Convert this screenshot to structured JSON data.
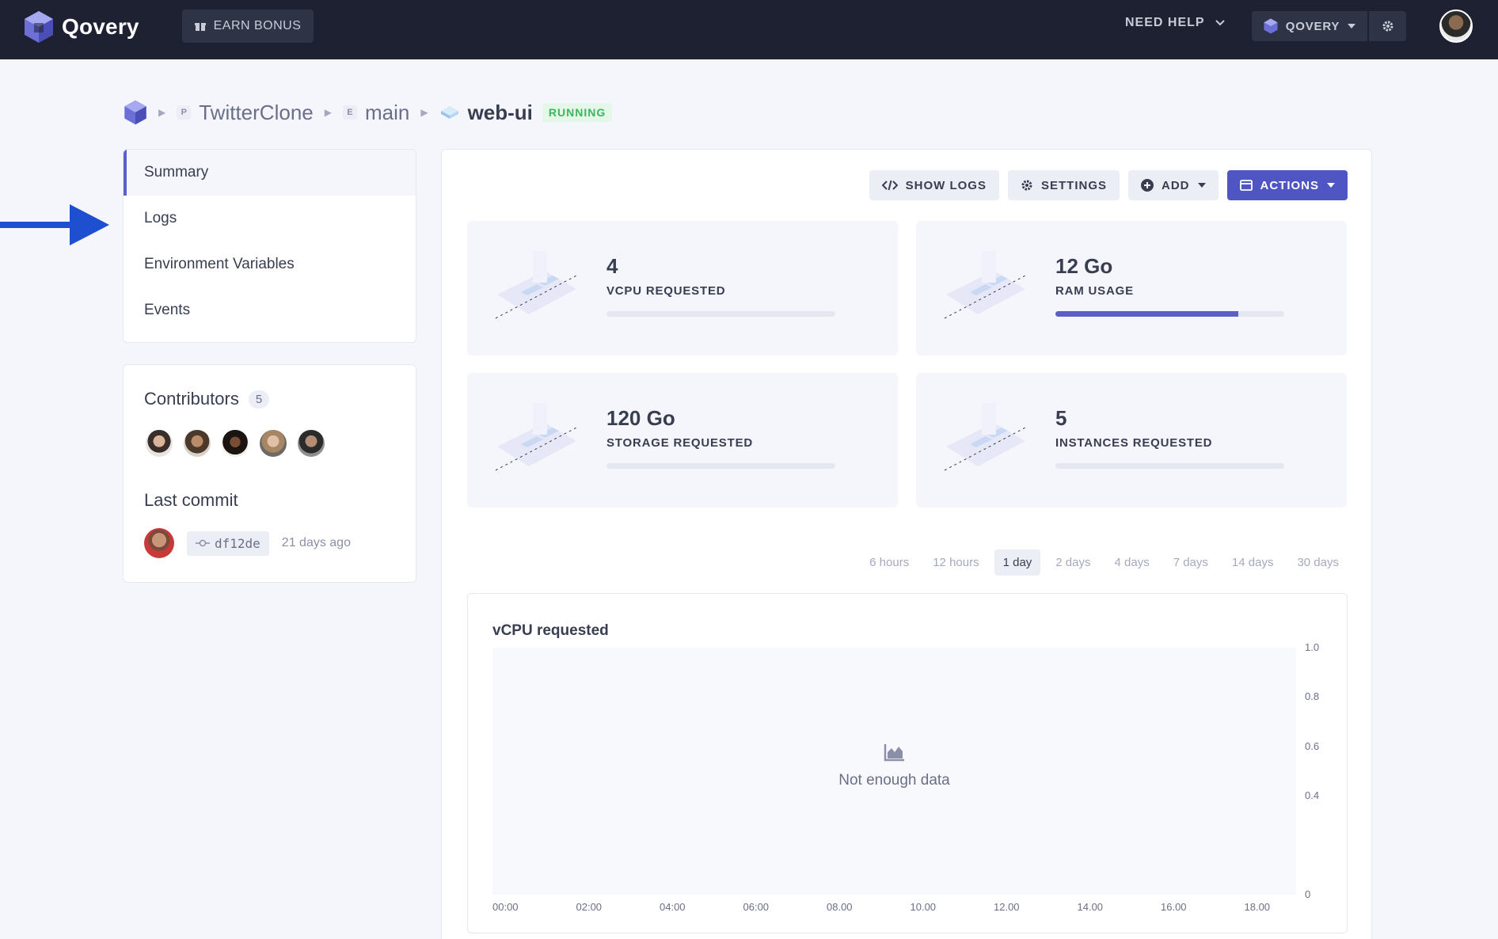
{
  "topbar": {
    "brand": "Qovery",
    "earn_bonus": "EARN BONUS",
    "need_help": "NEED HELP",
    "org_name": "QOVERY"
  },
  "breadcrumb": {
    "project_tag": "P",
    "project": "TwitterClone",
    "environment_tag": "E",
    "environment": "main",
    "application": "web-ui",
    "status": "RUNNING"
  },
  "sidebar": {
    "items": [
      {
        "label": "Summary",
        "active": true
      },
      {
        "label": "Logs",
        "active": false
      },
      {
        "label": "Environment Variables",
        "active": false
      },
      {
        "label": "Events",
        "active": false
      }
    ]
  },
  "contributors": {
    "title": "Contributors",
    "count": "5"
  },
  "last_commit": {
    "title": "Last commit",
    "hash": "df12de",
    "time_ago": "21 days ago"
  },
  "toolbar": {
    "show_logs": "SHOW LOGS",
    "settings": "SETTINGS",
    "add": "ADD",
    "actions": "ACTIONS"
  },
  "stats": [
    {
      "value": "4",
      "label": "VCPU REQUESTED",
      "fill": 0
    },
    {
      "value": "12 Go",
      "label": "RAM USAGE",
      "fill": 0.8
    },
    {
      "value": "120 Go",
      "label": "STORAGE REQUESTED",
      "fill": 0
    },
    {
      "value": "5",
      "label": "INSTANCES REQUESTED",
      "fill": 0
    }
  ],
  "time_ranges": [
    "6 hours",
    "12 hours",
    "1 day",
    "2 days",
    "4 days",
    "7 days",
    "14 days",
    "30 days"
  ],
  "selected_range": "1 day",
  "chart_data": {
    "type": "area",
    "title": "vCPU requested",
    "message": "Not enough data",
    "x_ticks": [
      "00:00",
      "02:00",
      "04:00",
      "06:00",
      "08.00",
      "10.00",
      "12.00",
      "14.00",
      "16.00",
      "18.00"
    ],
    "y_ticks": [
      "1.0",
      "0.8",
      "0.6",
      "0.4",
      "0"
    ],
    "ylim": [
      0,
      1.0
    ],
    "series": []
  },
  "colors": {
    "topbar": "#1e2131",
    "accent": "#4f55c3",
    "running": "#3cb65c",
    "arrow": "#1f4fd1"
  }
}
